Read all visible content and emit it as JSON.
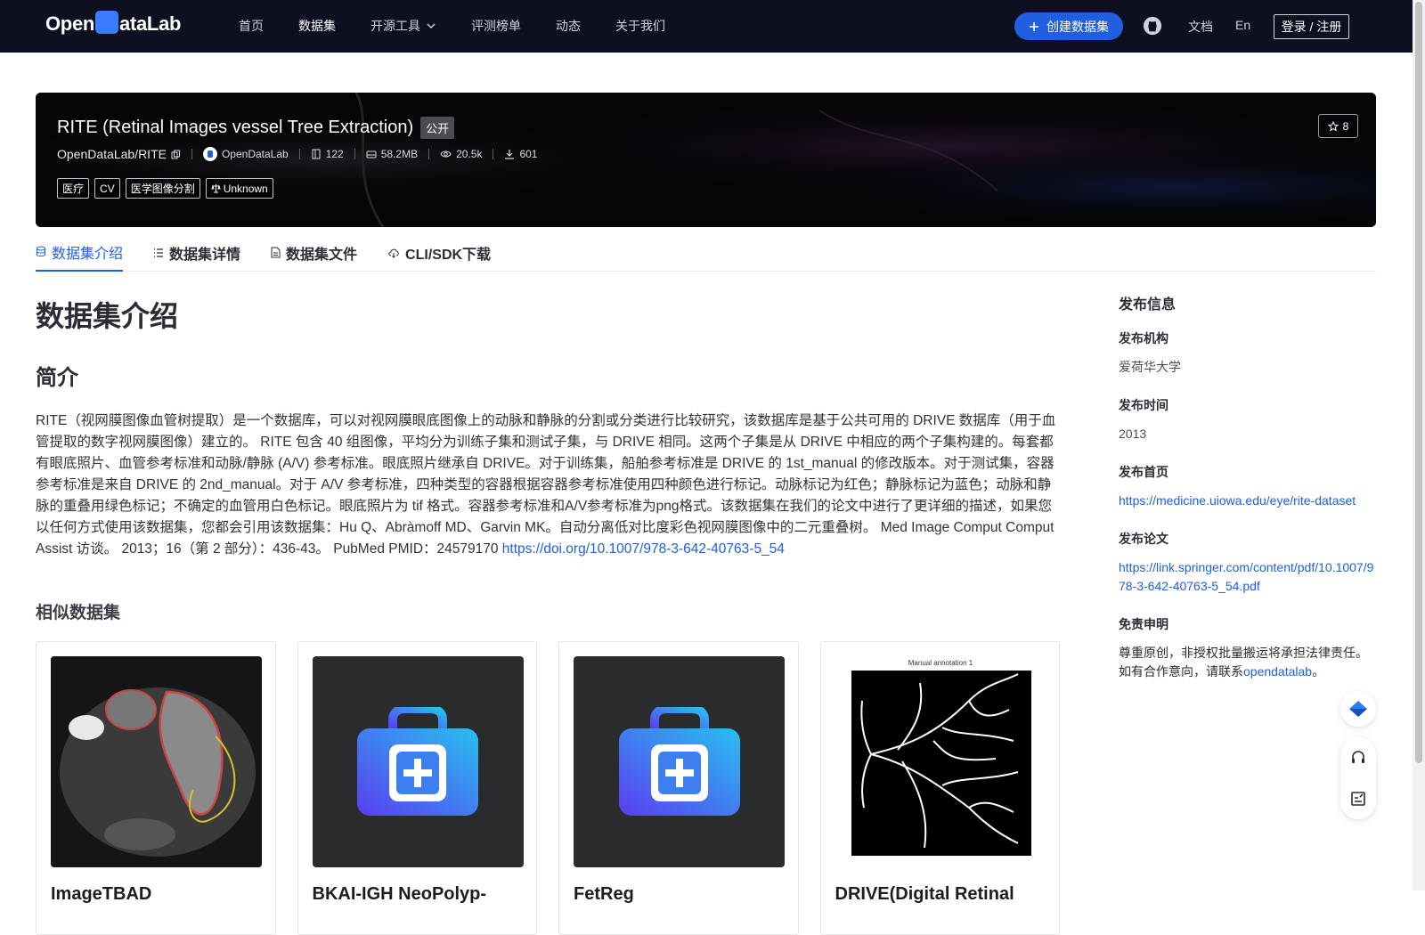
{
  "header": {
    "logo_left": "Open",
    "logo_right": "ataLab",
    "nav": [
      "首页",
      "数据集",
      "开源工具",
      "评测榜单",
      "动态",
      "关于我们"
    ],
    "create_label": "创建数据集",
    "docs_label": "文档",
    "lang_label": "En",
    "login_label": "登录 / 注册"
  },
  "banner": {
    "title": "RITE (Retinal Images vessel Tree Extraction)",
    "visibility": "公开",
    "star_count": "8",
    "path": "OpenDataLab/RITE",
    "publisher": "OpenDataLab",
    "files": "122",
    "size": "58.2MB",
    "views": "20.5k",
    "downloads": "601",
    "tags": [
      "医疗",
      "CV",
      "医学图像分割"
    ],
    "license": "Unknown"
  },
  "tabs": [
    "数据集介绍",
    "数据集详情",
    "数据集文件",
    "CLI/SDK下载"
  ],
  "main": {
    "heading": "数据集介绍",
    "subheading": "简介",
    "description": "RITE（视网膜图像血管树提取）是一个数据库，可以对视网膜眼底图像上的动脉和静脉的分割或分类进行比较研究，该数据库是基于公共可用的 DRIVE 数据库（用于血管提取的数字视网膜图像）建立的。 RITE 包含 40 组图像，平均分为训练子集和测试子集，与 DRIVE 相同。这两个子集是从 DRIVE 中相应的两个子集构建的。每套都有眼底照片、血管参考标准和动脉/静脉 (A/V) 参考标准。眼底照片继承自 DRIVE。对于训练集，船舶参考标准是 DRIVE 的 1st_manual 的修改版本。对于测试集，容器参考标准是来自 DRIVE 的 2nd_manual。对于 A/V 参考标准，四种类型的容器根据容器参考标准使用四种颜色进行标记。动脉标记为红色；静脉标记为蓝色；动脉和静脉的重叠用绿色标记；不确定的血管用白色标记。眼底照片为 tif 格式。容器参考标准和A/V参考标准为png格式。该数据集在我们的论文中进行了更详细的描述，如果您以任何方式使用该数据集，您都会引用该数据集：Hu Q、Abràmoff MD、Garvin MK。自动分离低对比度彩色视网膜图像中的二元重叠树。 Med Image Comput Comput Assist 访谈。 2013；16（第 2 部分）：436-43。 PubMed PMID：24579170 ",
    "doi_link": "https://doi.org/10.1007/978-3-642-40763-5_54",
    "similar_heading": "相似数据集",
    "cards": [
      {
        "title": "ImageTBAD"
      },
      {
        "title": "BKAI-IGH NeoPolyp-"
      },
      {
        "title": "FetReg"
      },
      {
        "title": "DRIVE(Digital Retinal",
        "image_caption": "Manual annotation 1"
      }
    ]
  },
  "sidebar": {
    "title": "发布信息",
    "org_label": "发布机构",
    "org_value": "爱荷华大学",
    "time_label": "发布时间",
    "time_value": "2013",
    "home_label": "发布首页",
    "home_value": "https://medicine.uiowa.edu/eye/rite-dataset",
    "paper_label": "发布论文",
    "paper_value": "https://link.springer.com/content/pdf/10.1007/978-3-642-40763-5_54.pdf",
    "disclaimer_label": "免责申明",
    "disclaimer_text": "尊重原创，非授权批量搬运将承担法律责任。如有合作意向，请联系",
    "disclaimer_link": "opendatalab",
    "disclaimer_end": "。"
  },
  "colors": {
    "accent": "#1f5fe0",
    "topbar": "#0c1020"
  }
}
